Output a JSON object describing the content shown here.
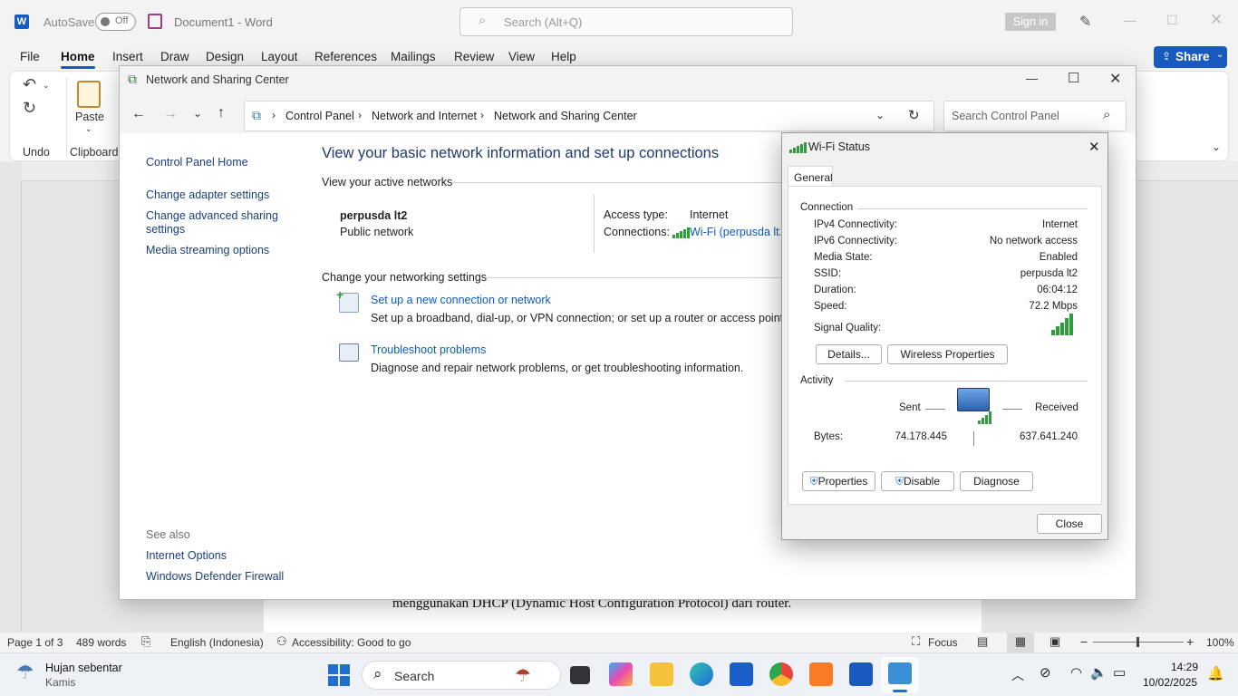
{
  "word": {
    "autosave_label": "AutoSave",
    "autosave_state": "Off",
    "doc_title": "Document1  -  Word",
    "search_placeholder": "Search (Alt+Q)",
    "signin": "Sign in",
    "share": "Share",
    "tabs": [
      "File",
      "Home",
      "Insert",
      "Draw",
      "Design",
      "Layout",
      "References",
      "Mailings",
      "Review",
      "View",
      "Help"
    ],
    "ribbon": {
      "undo_group": "Undo",
      "paste": "Paste",
      "clipboard_group": "Clipboard"
    },
    "doc_text": "menggunakan DHCP (Dynamic Host Configuration Protocol) dari router.",
    "status": {
      "page": "Page 1 of 3",
      "words": "489 words",
      "language": "English (Indonesia)",
      "accessibility": "Accessibility: Good to go",
      "focus": "Focus",
      "zoom": "100%"
    }
  },
  "cp": {
    "title": "Network and Sharing Center",
    "breadcrumb": [
      "Control Panel",
      "Network and Internet",
      "Network and Sharing Center"
    ],
    "search_placeholder": "Search Control Panel",
    "sidebar": {
      "home": "Control Panel Home",
      "links": [
        "Change adapter settings",
        "Change advanced sharing settings",
        "Media streaming options"
      ],
      "see_also": "See also",
      "see_also_links": [
        "Internet Options",
        "Windows Defender Firewall"
      ]
    },
    "heading": "View your basic network information and set up connections",
    "active_networks": "View your active networks",
    "network_name": "perpusda lt2",
    "network_type": "Public network",
    "access_type_label": "Access type:",
    "access_type_value": "Internet",
    "connections_label": "Connections:",
    "connections_value": "Wi-Fi (perpusda lt2)",
    "change_settings": "Change your networking settings",
    "tasks": [
      {
        "title": "Set up a new connection or network",
        "desc": "Set up a broadband, dial-up, or VPN connection; or set up a router or access point."
      },
      {
        "title": "Troubleshoot problems",
        "desc": "Diagnose and repair network problems, or get troubleshooting information."
      }
    ]
  },
  "wifi": {
    "title": "Wi-Fi Status",
    "tab": "General",
    "connection_header": "Connection",
    "rows": [
      {
        "label": "IPv4 Connectivity:",
        "value": "Internet"
      },
      {
        "label": "IPv6 Connectivity:",
        "value": "No network access"
      },
      {
        "label": "Media State:",
        "value": "Enabled"
      },
      {
        "label": "SSID:",
        "value": "perpusda lt2"
      },
      {
        "label": "Duration:",
        "value": "06:04:12"
      },
      {
        "label": "Speed:",
        "value": "72.2 Mbps"
      }
    ],
    "signal_label": "Signal Quality:",
    "signal_bars": 5,
    "details_btn": "Details...",
    "wireless_btn": "Wireless Properties",
    "activity_header": "Activity",
    "sent": "Sent",
    "received": "Received",
    "bytes_label": "Bytes:",
    "bytes_sent": "74.178.445",
    "bytes_received": "637.641.240",
    "properties_btn": "Properties",
    "disable_btn": "Disable",
    "diagnose_btn": "Diagnose",
    "close_btn": "Close"
  },
  "taskbar": {
    "weather_title": "Hujan sebentar",
    "weather_sub": "Kamis",
    "search": "Search",
    "time": "14:29",
    "date": "10/02/2025"
  },
  "colors": {
    "word_blue": "#185abd",
    "link": "#0d5db8",
    "signal_green": "#2e9e3a"
  }
}
